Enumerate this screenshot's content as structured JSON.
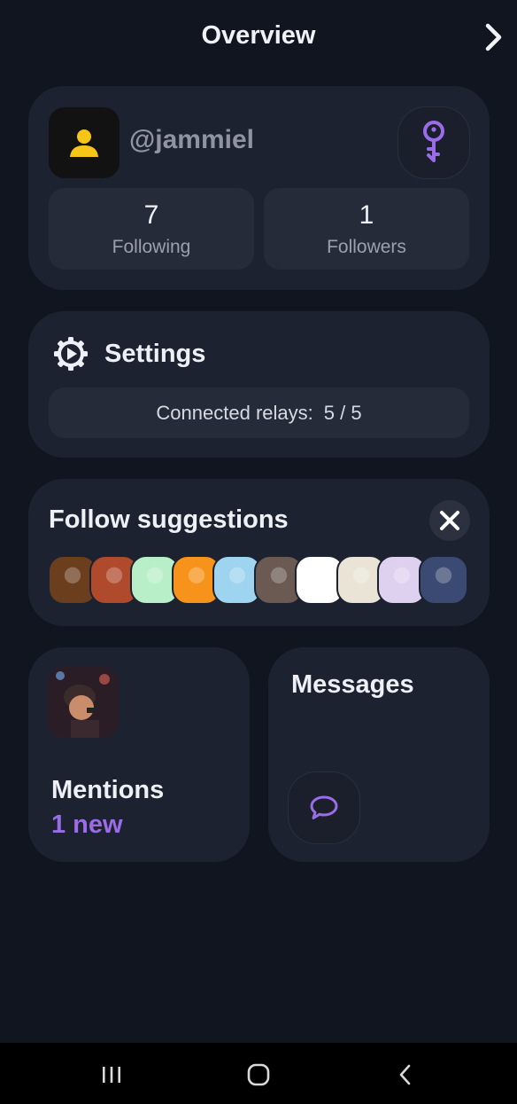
{
  "header": {
    "title": "Overview",
    "next_icon": "chevron-right-icon"
  },
  "profile": {
    "handle": "@jammiel",
    "avatar_icon": "user-silhouette-icon",
    "key_icon": "key-icon",
    "stats": [
      {
        "value": "7",
        "label": "Following"
      },
      {
        "value": "1",
        "label": "Followers"
      }
    ]
  },
  "settings": {
    "title": "Settings",
    "icon": "gear-icon",
    "relays_label": "Connected relays:",
    "relays_value": "5 / 5"
  },
  "suggestions": {
    "title": "Follow suggestions",
    "close_icon": "close-icon",
    "avatars": [
      {
        "name": "suggestion-avatar-1",
        "color": "#6b3f1e"
      },
      {
        "name": "suggestion-avatar-2",
        "color": "#b04a2c"
      },
      {
        "name": "suggestion-avatar-3",
        "color": "#b8efc8"
      },
      {
        "name": "suggestion-avatar-4",
        "color": "#f7931a"
      },
      {
        "name": "suggestion-avatar-5",
        "color": "#9ed4ef"
      },
      {
        "name": "suggestion-avatar-6",
        "color": "#6a5a52"
      },
      {
        "name": "suggestion-avatar-7",
        "color": "#ffffff"
      },
      {
        "name": "suggestion-avatar-8",
        "color": "#e9e4d6"
      },
      {
        "name": "suggestion-avatar-9",
        "color": "#ddd1ef"
      },
      {
        "name": "suggestion-avatar-10",
        "color": "#3a4a72"
      }
    ]
  },
  "mentions": {
    "title": "Mentions",
    "new_count_label": "1 new"
  },
  "messages": {
    "title": "Messages",
    "chat_icon": "chat-bubble-icon"
  },
  "system_nav": {
    "recents_icon": "recents-icon",
    "home_icon": "home-icon",
    "back_icon": "back-icon"
  },
  "colors": {
    "background": "#111520",
    "card": "#1d2230",
    "accent": "#9b6ce8",
    "avatar_yellow": "#f5c518"
  }
}
